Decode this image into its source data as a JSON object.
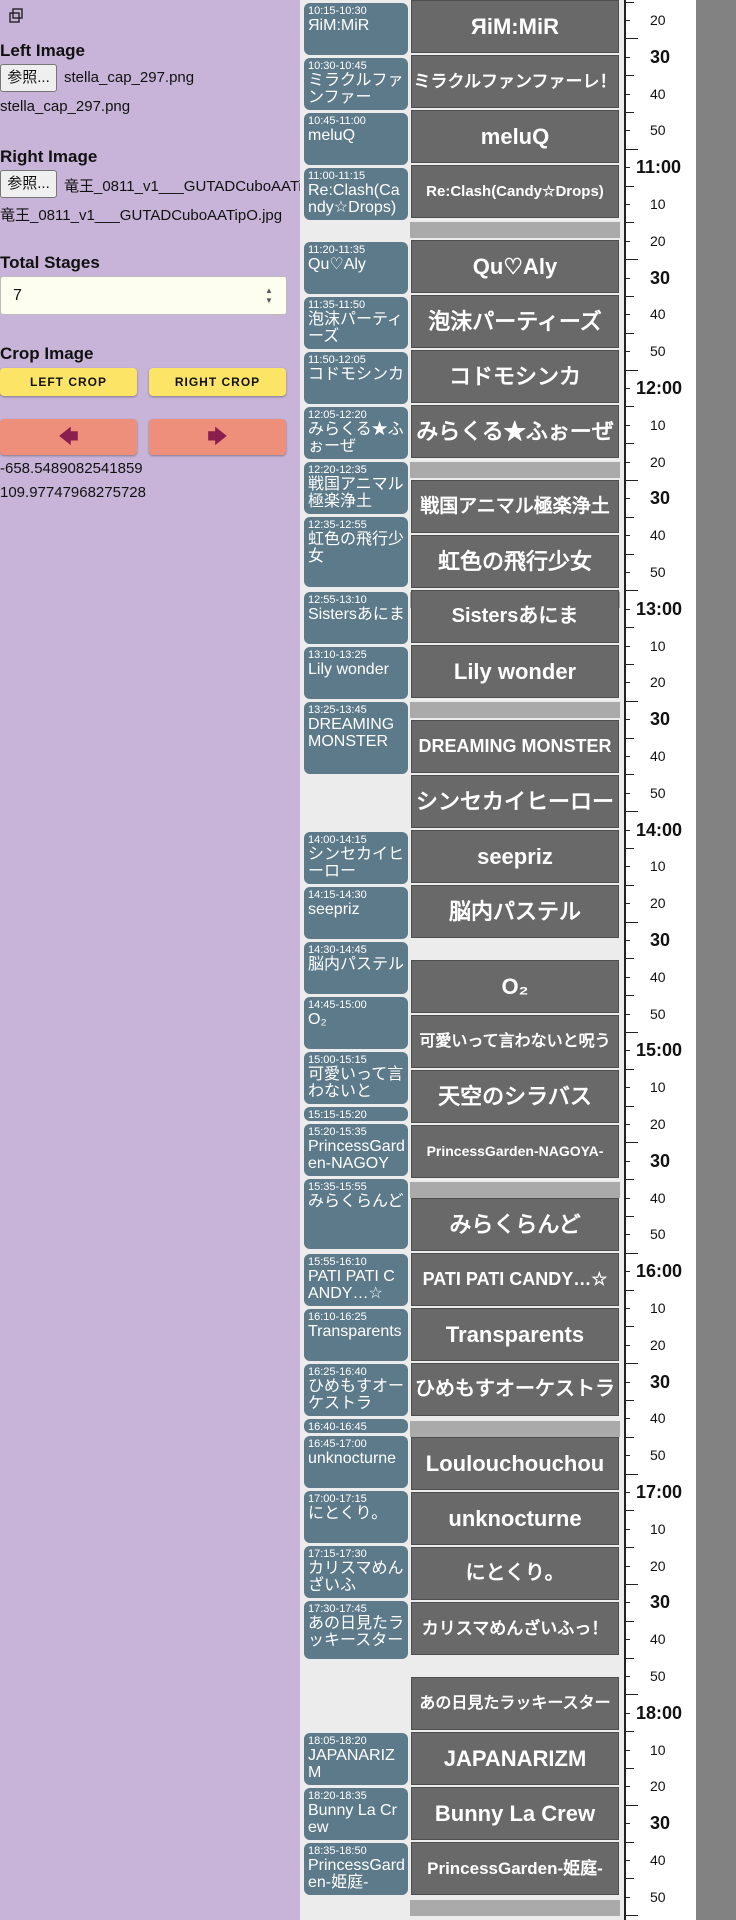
{
  "panel": {
    "toggle_icon": "copy-icon",
    "left_image": {
      "heading": "Left Image",
      "browse_label": "参照...",
      "file_name": "stella_cap_297.png",
      "file_display": "stella_cap_297.png"
    },
    "right_image": {
      "heading": "Right Image",
      "browse_label": "参照...",
      "file_name": "竜王_0811_v1___GUTADCuboAATipO.jpg",
      "file_display": "竜王_0811_v1___GUTADCuboAATipO.jpg"
    },
    "total_stages": {
      "heading": "Total Stages",
      "value": "7"
    },
    "crop": {
      "heading": "Crop Image",
      "left_label": "LEFT CROP",
      "right_label": "RIGHT CROP",
      "left_color": "#fce566"
    },
    "nav": {
      "prev_icon": "arrow-left-icon",
      "next_icon": "arrow-right-icon",
      "color": "#ee8f7b"
    },
    "coords": {
      "x": "-658.5489082541859",
      "y": "109.97747968275728"
    }
  },
  "timeline": {
    "cards": [
      {
        "time": "10:15-10:30",
        "name": "ЯiM:MiR"
      },
      {
        "time": "10:30-10:45",
        "name": "ミラクルファンファー"
      },
      {
        "time": "10:45-11:00",
        "name": "meluQ"
      },
      {
        "time": "11:00-11:15",
        "name": "Re:Clash(Candy☆Drops)"
      },
      {
        "time": "11:20-11:35",
        "name": "Qu♡Aly"
      },
      {
        "time": "11:35-11:50",
        "name": "泡沫パーティーズ"
      },
      {
        "time": "11:50-12:05",
        "name": "コドモシンカ"
      },
      {
        "time": "12:05-12:20",
        "name": "みらくる★ふぉーぜ"
      },
      {
        "time": "12:20-12:35",
        "name": "戦国アニマル極楽浄土"
      },
      {
        "time": "12:35-12:55",
        "name": "虹色の飛行少女"
      },
      {
        "time": "12:55-13:10",
        "name": "Sistersあにま"
      },
      {
        "time": "13:10-13:25",
        "name": "Lily wonder"
      },
      {
        "time": "13:25-13:45",
        "name": "DREAMING MONSTER"
      },
      {
        "time": "14:00-14:15",
        "name": "シンセカイヒーロー"
      },
      {
        "time": "14:15-14:30",
        "name": "seepriz"
      },
      {
        "time": "14:30-14:45",
        "name": "脳内パステル"
      },
      {
        "time": "14:45-15:00",
        "name": "O₂"
      },
      {
        "time": "15:00-15:15",
        "name": "可愛いって言わないと"
      },
      {
        "time": "15:15-15:20",
        "name": ""
      },
      {
        "time": "15:20-15:35",
        "name": "PrincessGarden-NAGOY"
      },
      {
        "time": "15:35-15:55",
        "name": "みらくらんど"
      },
      {
        "time": "15:55-16:10",
        "name": "PATI PATI CANDY…☆"
      },
      {
        "time": "16:10-16:25",
        "name": "Transparents"
      },
      {
        "time": "16:25-16:40",
        "name": "ひめもすオーケストラ"
      },
      {
        "time": "16:40-16:45",
        "name": ""
      },
      {
        "time": "16:45-17:00",
        "name": "unknocturne"
      },
      {
        "time": "17:00-17:15",
        "name": "にとくり。"
      },
      {
        "time": "17:15-17:30",
        "name": "カリスマめんざいふ"
      },
      {
        "time": "17:30-17:45",
        "name": "あの日見たラッキースター"
      },
      {
        "time": "18:05-18:20",
        "name": "JAPANARIZM"
      },
      {
        "time": "18:20-18:35",
        "name": "Bunny La Crew"
      },
      {
        "time": "18:35-18:50",
        "name": "PrincessGarden-姫庭-"
      }
    ],
    "blocks": [
      "ЯiM:MiR",
      "ミラクルファンファーレ！",
      "meluQ",
      "Re:Clash(Candy☆Drops)",
      "Qu♡Aly",
      "泡沫パーティーズ",
      "コドモシンカ",
      "みらくる★ふぉーぜ",
      "戦国アニマル極楽浄土",
      "虹色の飛行少女",
      "Sistersあにま",
      "Lily wonder",
      "DREAMING MONSTER",
      "シンセカイヒーロー",
      "seepriz",
      "脳内パステル",
      "O₂",
      "可愛いって言わないと呪う",
      "天空のシラバス",
      "PrincessGarden-NAGOYA-",
      "みらくらんど",
      "PATI PATI CANDY…☆",
      "Transparents",
      "ひめもすオーケストラ",
      "Loulouchouchou",
      "unknocturne",
      "にとくり。",
      "カリスマめんざいふっ！",
      "あの日見たラッキースター",
      "JAPANARIZM",
      "Bunny La Crew",
      "PrincessGarden-姫庭-"
    ]
  },
  "ruler": {
    "labels": [
      "20",
      "30",
      "40",
      "50",
      "11:00",
      "10",
      "20",
      "30",
      "40",
      "50",
      "12:00",
      "10",
      "20",
      "30",
      "40",
      "50",
      "13:00",
      "10",
      "20",
      "30",
      "40",
      "50",
      "14:00",
      "10",
      "20",
      "30",
      "40",
      "50",
      "15:00",
      "10",
      "20",
      "30",
      "40",
      "50",
      "16:00",
      "10",
      "20",
      "30",
      "40",
      "50",
      "17:00",
      "10",
      "20",
      "30",
      "40",
      "50",
      "18:00",
      "10",
      "20",
      "30",
      "40",
      "50"
    ]
  }
}
